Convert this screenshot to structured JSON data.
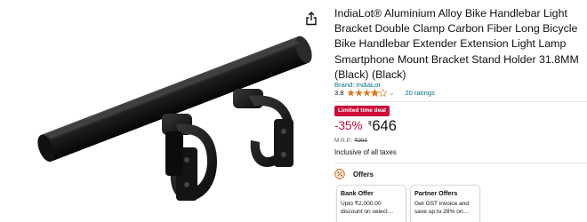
{
  "product": {
    "title": "IndiaLot® Aluminium Alloy Bike Handlebar Light Bracket Double Clamp Carbon Fiber Long Bicycle Bike Handlebar Extender Extension Light Lamp Smartphone Mount Bracket Stand Holder 31.8MM (Black) (Black)",
    "brand_link": "Brand: IndiaLot",
    "rating_value": "3.8",
    "rating_stars": 3.8,
    "ratings_count": "20 ratings",
    "caret": "⌄"
  },
  "deal": {
    "badge": "Limited time deal",
    "discount": "-35%",
    "currency_symbol": "₹",
    "price": "646",
    "mrp_label": "M.R.P.:",
    "mrp_value": "₹999",
    "tax_note": "Inclusive of all taxes"
  },
  "offers": {
    "heading": "Offers",
    "cards": [
      {
        "title": "Bank Offer",
        "line1": "Upto ₹2,000.00",
        "line2": "discount on select…"
      },
      {
        "title": "Partner Offers",
        "line1": "Get GST invoice and",
        "line2": "save up to 28% on…"
      }
    ]
  },
  "icons": {
    "share": "share-icon",
    "star": "star-icon",
    "offers": "offers-percent-icon"
  },
  "colors": {
    "deal_red": "#cc0c39",
    "star_orange": "#de7921",
    "link_teal": "#007185",
    "text": "#0f1111",
    "muted": "#565959"
  }
}
